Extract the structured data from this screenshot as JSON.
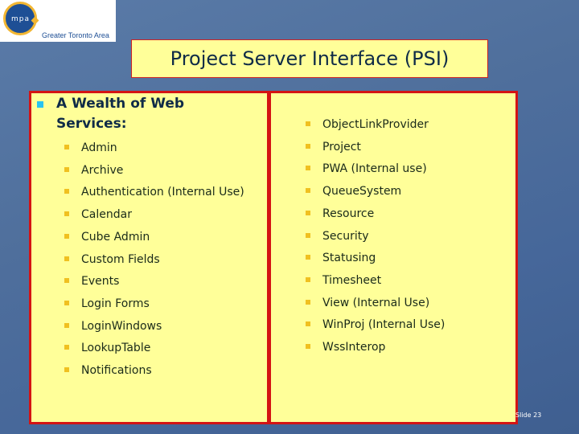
{
  "logo": {
    "mark_text": "mpa",
    "caption": "Greater Toronto Area",
    "colors": {
      "circle": "#1e4f95",
      "ring": "#f2b632"
    }
  },
  "title": "Project Server Interface (PSI)",
  "heading": "A Wealth of Web Services:",
  "left_items": [
    "Admin",
    "Archive",
    "Authentication (Internal Use)",
    "Calendar",
    "Cube Admin",
    "Custom Fields",
    "Events",
    "Login Forms",
    "LoginWindows",
    "LookupTable",
    "Notifications"
  ],
  "right_items": [
    "ObjectLinkProvider",
    "Project",
    "PWA (Internal use)",
    "QueueSystem",
    "Resource",
    "Security",
    "Statusing",
    "Timesheet",
    "View (Internal Use)",
    "WinProj (Internal Use)",
    "WssInterop"
  ],
  "footer": {
    "slide_label": "Slide 23"
  },
  "colors": {
    "panel": "#ffff99",
    "border": "#d41414",
    "main_bullet": "#29c3f0",
    "sub_bullet": "#f0c020"
  }
}
